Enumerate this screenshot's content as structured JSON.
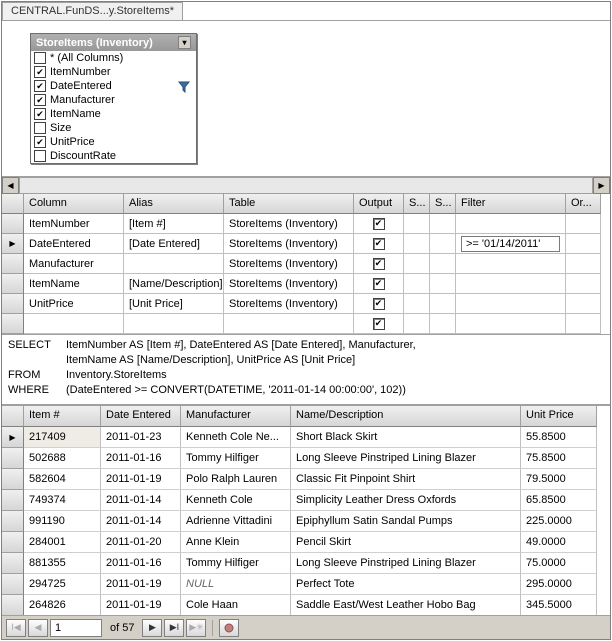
{
  "tab_title": "CENTRAL.FunDS...y.StoreItems*",
  "table_box": {
    "title": "StoreItems (Inventory)",
    "columns": [
      {
        "name": "* (All Columns)",
        "checked": false
      },
      {
        "name": "ItemNumber",
        "checked": true
      },
      {
        "name": "DateEntered",
        "checked": true,
        "filter": true
      },
      {
        "name": "Manufacturer",
        "checked": true
      },
      {
        "name": "ItemName",
        "checked": true
      },
      {
        "name": "Size",
        "checked": false
      },
      {
        "name": "UnitPrice",
        "checked": true
      },
      {
        "name": "DiscountRate",
        "checked": false
      }
    ]
  },
  "criteria": {
    "headers": {
      "column": "Column",
      "alias": "Alias",
      "table": "Table",
      "output": "Output",
      "s1": "S...",
      "s2": "S...",
      "filter": "Filter",
      "or": "Or..."
    },
    "rows": [
      {
        "column": "ItemNumber",
        "alias": "[Item #]",
        "table": "StoreItems (Inventory)",
        "output": true,
        "filter": "",
        "selected": false
      },
      {
        "column": "DateEntered",
        "alias": "[Date Entered]",
        "table": "StoreItems (Inventory)",
        "output": true,
        "filter": ">= '01/14/2011'",
        "selected": true
      },
      {
        "column": "Manufacturer",
        "alias": "",
        "table": "StoreItems (Inventory)",
        "output": true,
        "filter": "",
        "selected": false
      },
      {
        "column": "ItemName",
        "alias": "[Name/Description]",
        "table": "StoreItems (Inventory)",
        "output": true,
        "filter": "",
        "selected": false
      },
      {
        "column": "UnitPrice",
        "alias": "[Unit Price]",
        "table": "StoreItems (Inventory)",
        "output": true,
        "filter": "",
        "selected": false
      },
      {
        "column": "",
        "alias": "",
        "table": "",
        "output": true,
        "filter": "",
        "selected": false
      }
    ]
  },
  "sql": {
    "select_kw": "SELECT",
    "select_l1": "ItemNumber AS [Item #], DateEntered AS [Date Entered], Manufacturer,",
    "select_l2": "ItemName AS [Name/Description], UnitPrice AS [Unit Price]",
    "from_kw": "FROM",
    "from_body": "Inventory.StoreItems",
    "where_kw": "WHERE",
    "where_body": "(DateEntered >= CONVERT(DATETIME, '2011-01-14 00:00:00', 102))"
  },
  "results": {
    "headers": {
      "item": "Item #",
      "date": "Date Entered",
      "manu": "Manufacturer",
      "name": "Name/Description",
      "price": "Unit Price"
    },
    "rows": [
      {
        "item": "217409",
        "date": "2011-01-23",
        "manu": "Kenneth Cole Ne...",
        "name": "Short Black Skirt",
        "price": "55.8500",
        "selected": true
      },
      {
        "item": "502688",
        "date": "2011-01-16",
        "manu": "Tommy Hilfiger",
        "name": "Long Sleeve Pinstriped Lining Blazer",
        "price": "75.8500"
      },
      {
        "item": "582604",
        "date": "2011-01-19",
        "manu": "Polo Ralph Lauren",
        "name": "Classic Fit Pinpoint Shirt",
        "price": "79.5000"
      },
      {
        "item": "749374",
        "date": "2011-01-14",
        "manu": "Kenneth Cole",
        "name": "Simplicity Leather Dress Oxfords",
        "price": "65.8500"
      },
      {
        "item": "991190",
        "date": "2011-01-14",
        "manu": "Adrienne Vittadini",
        "name": "Epiphyllum Satin Sandal Pumps",
        "price": "225.0000"
      },
      {
        "item": "284001",
        "date": "2011-01-20",
        "manu": "Anne Klein",
        "name": "Pencil Skirt",
        "price": "49.0000"
      },
      {
        "item": "881355",
        "date": "2011-01-16",
        "manu": "Tommy Hilfiger",
        "name": "Long Sleeve Pinstriped Lining Blazer",
        "price": "75.0000"
      },
      {
        "item": "294725",
        "date": "2011-01-19",
        "manu": "NULL",
        "name": "Perfect Tote",
        "price": "295.0000",
        "null_manu": true
      },
      {
        "item": "264826",
        "date": "2011-01-19",
        "manu": "Cole Haan",
        "name": "Saddle East/West Leather Hobo Bag",
        "price": "345.5000"
      }
    ]
  },
  "nav": {
    "page": "1",
    "of": "of 57"
  }
}
